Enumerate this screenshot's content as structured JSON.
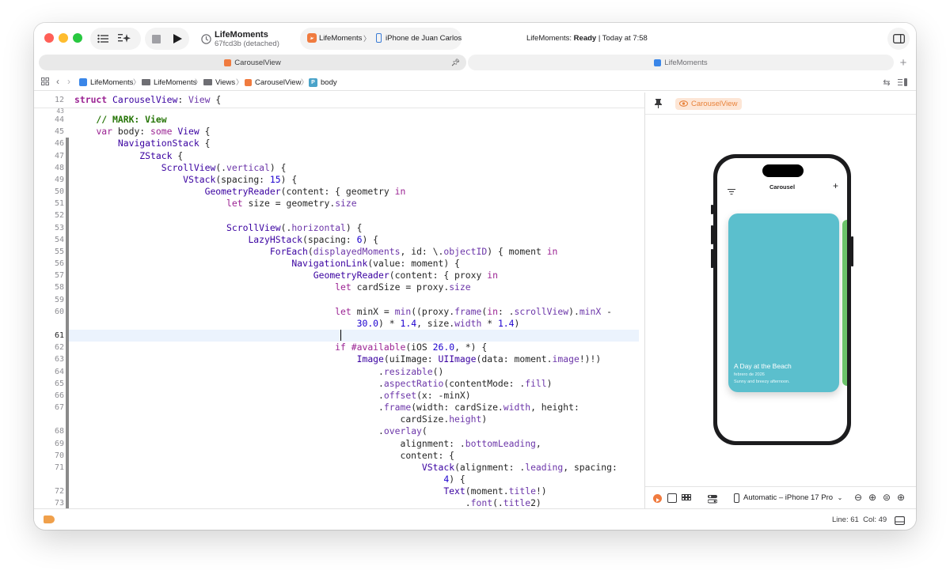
{
  "toolbar": {
    "project_name": "LifeMoments",
    "commit": "67fcd3b (detached)",
    "scheme": "LifeMoments",
    "device": "iPhone de Juan Carlos",
    "status_app": "LifeMoments:",
    "status_state": "Ready",
    "status_time": "| Today at 7:58"
  },
  "tabs": [
    {
      "label": "CarouselView",
      "icon": "swift-file-icon",
      "active": true
    },
    {
      "label": "LifeMoments",
      "icon": "project-icon",
      "active": false
    }
  ],
  "breadcrumb": [
    "LifeMoments",
    "LifeMoments",
    "Views",
    "CarouselView",
    "body"
  ],
  "editor": {
    "sticky": {
      "line": "12",
      "text": "struct CarouselView: View {"
    },
    "current_line": "61",
    "lines": [
      {
        "n": "44",
        "code": "    // MARK: View"
      },
      {
        "n": "45",
        "code": "    var body: some View {"
      },
      {
        "n": "46",
        "code": "        NavigationStack {"
      },
      {
        "n": "47",
        "code": "            ZStack {"
      },
      {
        "n": "48",
        "code": "                ScrollView(.vertical) {"
      },
      {
        "n": "49",
        "code": "                    VStack(spacing: 15) {"
      },
      {
        "n": "50",
        "code": "                        GeometryReader(content: { geometry in"
      },
      {
        "n": "51",
        "code": "                            let size = geometry.size"
      },
      {
        "n": "52",
        "code": ""
      },
      {
        "n": "53",
        "code": "                            ScrollView(.horizontal) {"
      },
      {
        "n": "54",
        "code": "                                LazyHStack(spacing: 6) {"
      },
      {
        "n": "55",
        "code": "                                    ForEach(displayedMoments, id: \\.objectID) { moment in"
      },
      {
        "n": "56",
        "code": "                                        NavigationLink(value: moment) {"
      },
      {
        "n": "57",
        "code": "                                            GeometryReader(content: { proxy in"
      },
      {
        "n": "58",
        "code": "                                                let cardSize = proxy.size"
      },
      {
        "n": "59",
        "code": ""
      },
      {
        "n": "60",
        "code": "                                                let minX = min((proxy.frame(in: .scrollView).minX -"
      },
      {
        "n": "",
        "code": "                                                    30.0) * 1.4, size.width * 1.4)"
      },
      {
        "n": "61",
        "code": ""
      },
      {
        "n": "62",
        "code": "                                                if #available(iOS 26.0, *) {"
      },
      {
        "n": "63",
        "code": "                                                    Image(uiImage: UIImage(data: moment.image!)!)"
      },
      {
        "n": "64",
        "code": "                                                        .resizable()"
      },
      {
        "n": "65",
        "code": "                                                        .aspectRatio(contentMode: .fill)"
      },
      {
        "n": "66",
        "code": "                                                        .offset(x: -minX)"
      },
      {
        "n": "67",
        "code": "                                                        .frame(width: cardSize.width, height:"
      },
      {
        "n": "",
        "code": "                                                            cardSize.height)"
      },
      {
        "n": "68",
        "code": "                                                        .overlay("
      },
      {
        "n": "69",
        "code": "                                                            alignment: .bottomLeading,"
      },
      {
        "n": "70",
        "code": "                                                            content: {"
      },
      {
        "n": "71",
        "code": "                                                                VStack(alignment: .leading, spacing:"
      },
      {
        "n": "",
        "code": "                                                                    4) {"
      },
      {
        "n": "72",
        "code": "                                                                    Text(moment.title!)"
      },
      {
        "n": "73",
        "code": "                                                                        .font(.title2)"
      }
    ]
  },
  "canvas": {
    "badge": "CarouselView",
    "device_picker": "Automatic – iPhone 17 Pro",
    "preview": {
      "nav_title": "Carousel",
      "card_title": "A Day at the Beach",
      "card_date": "febrero de 2026",
      "card_desc": "Sunny and breezy afternoon."
    }
  },
  "statusbar": {
    "position": "Line: 61  Col: 49"
  },
  "colors": {
    "accent": "#f0a04b",
    "card": "#5bbfcd",
    "keyword": "#9b2393"
  }
}
